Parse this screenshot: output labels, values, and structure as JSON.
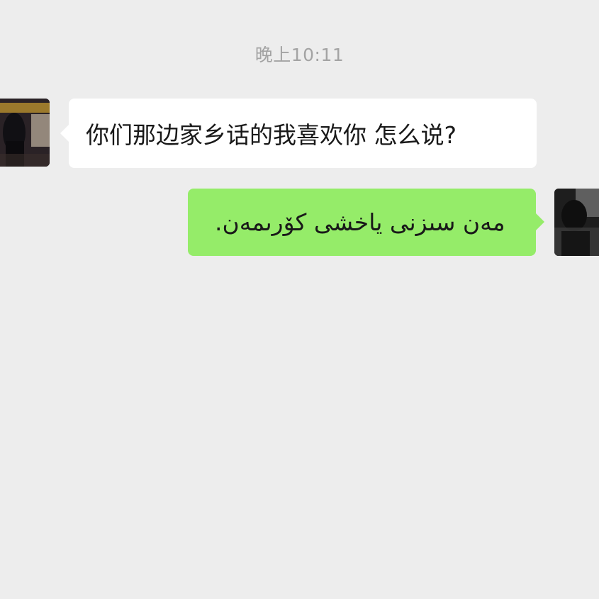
{
  "chat": {
    "timestamp": "晚上10:11",
    "messages": [
      {
        "side": "left",
        "text": "你们那边家乡话的我喜欢你 怎么说?",
        "bubble_color": "#ffffff"
      },
      {
        "side": "right",
        "text": "مەن سىزنى ياخشى كۆرىمەن.",
        "bubble_color": "#95ec69"
      }
    ]
  },
  "colors": {
    "background": "#ededed",
    "incoming_bubble": "#ffffff",
    "outgoing_bubble": "#95ec69",
    "timestamp_text": "#a3a3a3",
    "message_text": "#191919"
  },
  "icons": {
    "left_avatar": "contact-avatar-photo",
    "right_avatar": "self-avatar-photo"
  }
}
